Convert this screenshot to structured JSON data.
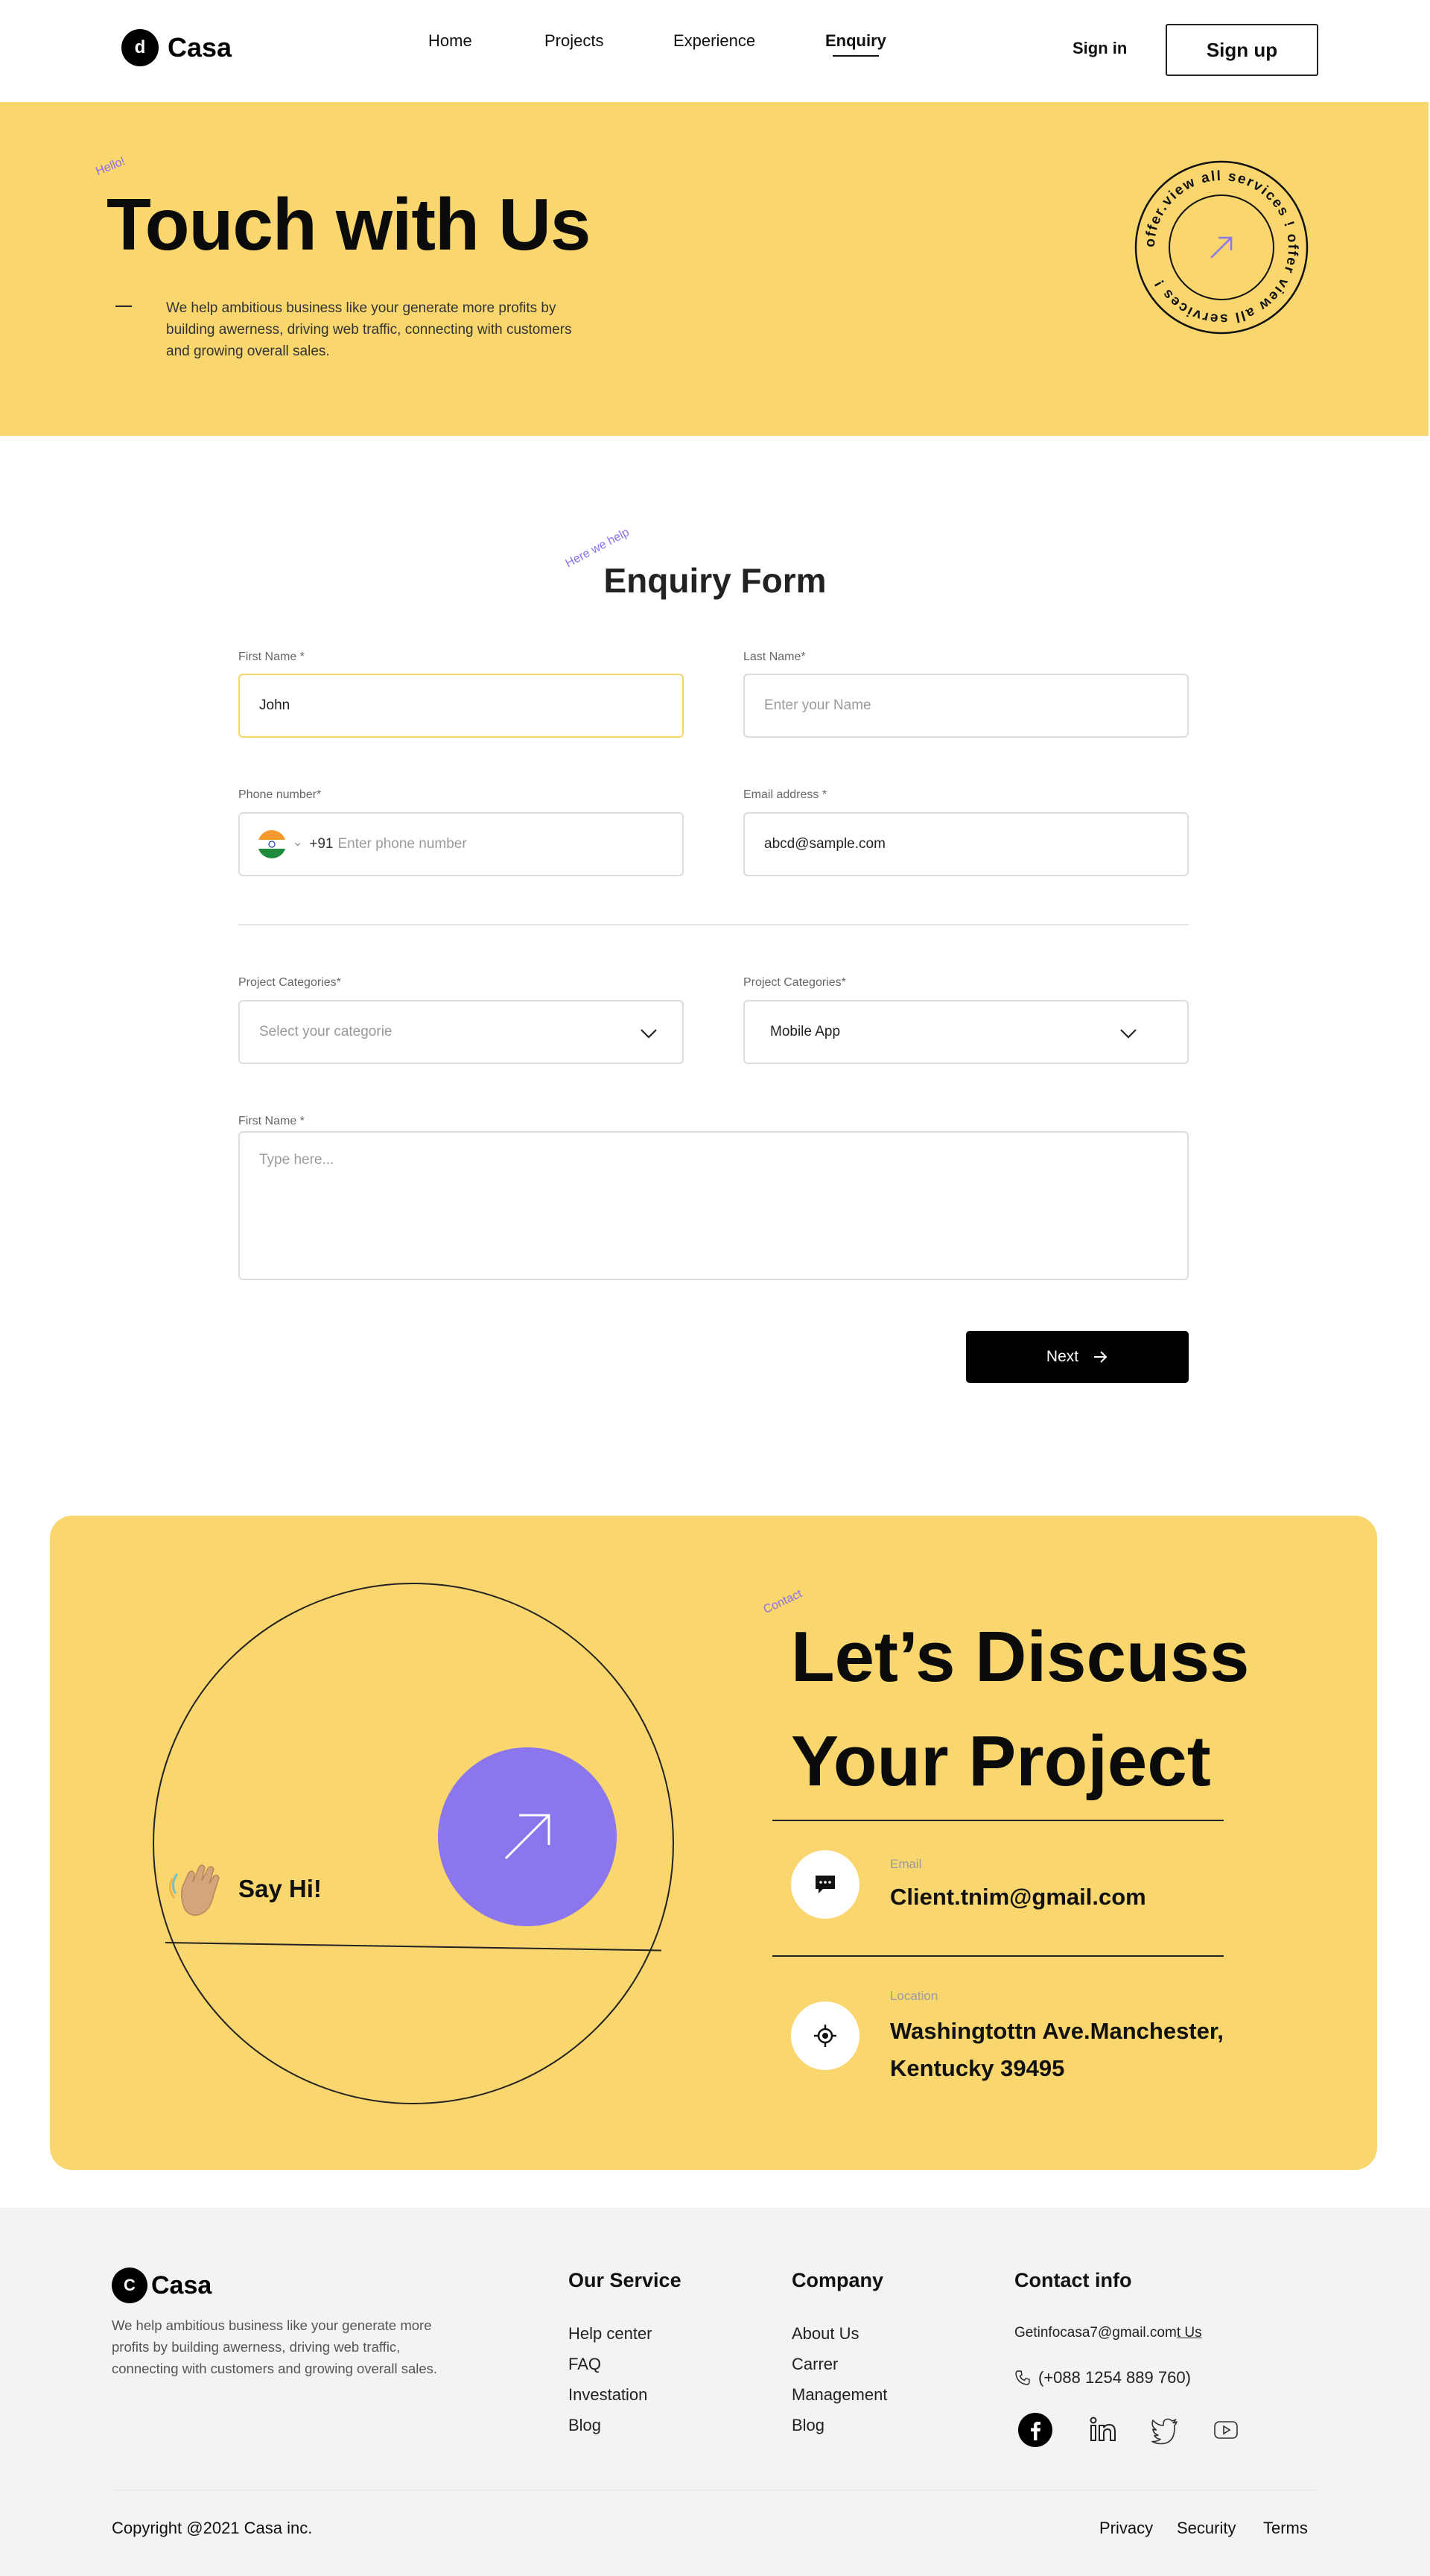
{
  "brand": {
    "logo_letter": "d",
    "name": "Casa"
  },
  "nav": {
    "links": [
      "Home",
      "Projects",
      "Experience",
      "Enquiry"
    ],
    "active": "Enquiry",
    "signin": "Sign in",
    "signup": "Sign up"
  },
  "hero": {
    "tag": "Hello!",
    "title": "Touch with Us",
    "description": "We help ambitious business like your generate more profits by building awerness, driving web traffic, connecting with customers and growing overall sales.",
    "badge_text": "offer.view all services ! offer view all services ! "
  },
  "form": {
    "tag": "Here we help",
    "title": "Enquiry Form",
    "first_name": {
      "label": "First Name *",
      "value": "John"
    },
    "last_name": {
      "label": "Last Name*",
      "placeholder": "Enter your Name"
    },
    "phone": {
      "label": "Phone number*",
      "code": "+91",
      "placeholder": "Enter phone number"
    },
    "email": {
      "label": "Email address *",
      "value": "abcd@sample.com"
    },
    "category_1": {
      "label": "Project Categories*",
      "placeholder": "Select your categorie"
    },
    "category_2": {
      "label": "Project Categories*",
      "value": "Mobile App"
    },
    "message": {
      "label": "First Name *",
      "placeholder": "Type here..."
    },
    "next_label": "Next"
  },
  "contact": {
    "tag": "Contact",
    "title_line1": "Let’s Discuss",
    "title_line2": "Your Project",
    "say_hi": "Say Hi!",
    "email_label": "Email",
    "email_value": "Client.tnim@gmail.com",
    "location_label": "Location",
    "location_line1": "Washingtottn Ave.Manchester,",
    "location_line2": "Kentucky 39495"
  },
  "footer": {
    "logo_letter": "C",
    "name": "Casa",
    "description": "We help ambitious business like your generate more profits by building awerness, driving web traffic, connecting with customers and growing overall sales.",
    "services": {
      "title": "Our Service",
      "items": [
        "Help center",
        "FAQ",
        "Investation",
        "Blog"
      ]
    },
    "company": {
      "title": "Company",
      "items": [
        "About Us",
        "Carrer",
        "Management",
        "Blog"
      ]
    },
    "contact": {
      "title": "Contact info",
      "email": "Getinfocasa7@gmail.com",
      "email_suffix": "t Us",
      "phone": "(+088 1254 889  760)"
    },
    "copyright": "Copyright @2021 Casa inc.",
    "bottom_links": [
      "Privacy",
      "Security",
      "Terms"
    ]
  },
  "colors": {
    "yellow": "#F9D66E",
    "purple": "#8B76EE",
    "black": "#000000"
  }
}
